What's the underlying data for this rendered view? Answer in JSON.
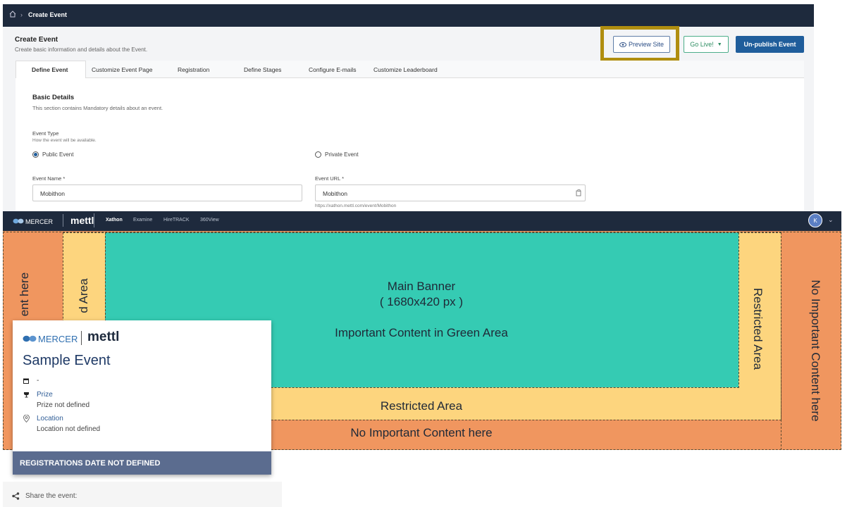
{
  "breadcrumb": {
    "current": "Create Event"
  },
  "header": {
    "title": "Create Event",
    "subtitle": "Create basic information and details about the Event."
  },
  "actions": {
    "preview": "Preview Site",
    "go_live": "Go Live!",
    "unpublish": "Un-publish Event"
  },
  "tabs": [
    "Define Event",
    "Customize Event Page",
    "Registration",
    "Define Stages",
    "Configure E-mails",
    "Customize Leaderboard"
  ],
  "basic": {
    "title": "Basic Details",
    "subtitle": "This section contains Mandatory details about an event."
  },
  "event_type": {
    "label": "Event Type",
    "hint": "How the event will be available.",
    "public": "Public Event",
    "private": "Private Event"
  },
  "event_name": {
    "label": "Event Name *",
    "value": "Mobithon"
  },
  "event_url": {
    "label": "Event URL *",
    "value": "Mobithon",
    "hint": "https://xathon.mettl.com/event/Mobithon"
  },
  "nav": {
    "brand": "MERCER",
    "product": "mettl",
    "links": [
      "Xathon",
      "Examine",
      "HireTRACK",
      "360View"
    ],
    "avatar": "K"
  },
  "banner": {
    "title": "Main Banner",
    "size": "( 1680x420 px )",
    "important": "Important Content in Green Area",
    "restricted_bottom": "Restricted Area",
    "no_important_bottom": "No Important Content here",
    "restricted_right": "Restricted Area",
    "no_important_right": "No Important Content here",
    "left_partial_outer": "ent here",
    "left_partial_inner": "d Area"
  },
  "card": {
    "brand": "MERCER",
    "product": "mettl",
    "title": "Sample Event",
    "date": "-",
    "prize_label": "Prize",
    "prize_value": "Prize not defined",
    "location_label": "Location",
    "location_value": "Location not defined",
    "registration": "REGISTRATIONS DATE NOT DEFINED"
  },
  "share": {
    "label": "Share the event:"
  },
  "colors": {
    "nav": "#1e2a3d",
    "green": "#35cbb3",
    "yellow": "#fdd57e",
    "orange": "#f0965f",
    "highlight": "#b08e10",
    "primary": "#1f5d9b"
  }
}
